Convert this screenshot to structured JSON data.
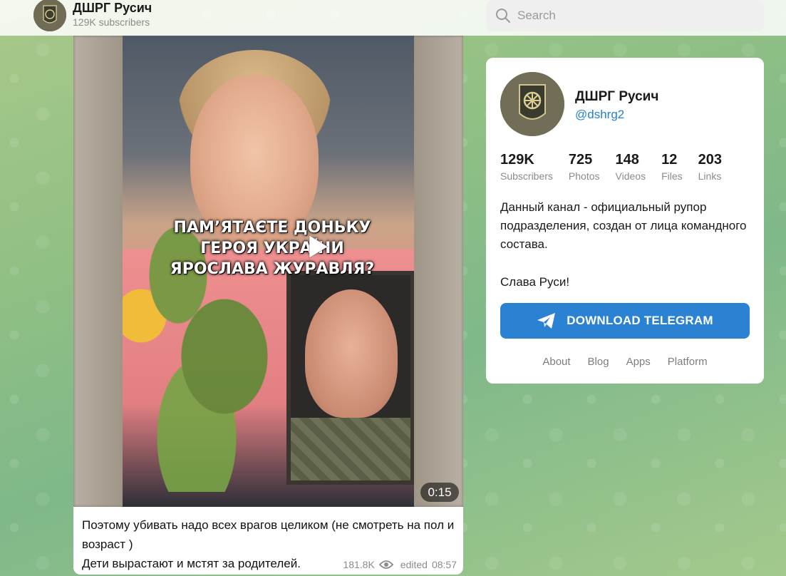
{
  "header": {
    "channel_name": "ДШРГ Русич",
    "subscribers_text": "129K subscribers",
    "avatar_icon": "channel-patch-avatar"
  },
  "search": {
    "placeholder": "Search",
    "icon": "search-icon"
  },
  "post": {
    "video": {
      "overlay_caption_lines": [
        "ПАМ’ЯТАЄТЕ ДОНЬКУ",
        "ГЕРОЯ УКРАЇНИ",
        "ЯРОСЛАВА ЖУРАВЛЯ?"
      ],
      "duration": "0:15",
      "play_icon": "play-icon"
    },
    "text_lines": [
      "Поэтому убивать надо всех врагов целиком (не смотреть на пол и возраст )",
      "Дети вырастают и мстят за родителей."
    ],
    "views": "181.8K",
    "edited_label": "edited",
    "time": "08:57"
  },
  "channel_card": {
    "name": "ДШРГ Русич",
    "handle": "@dshrg2",
    "stats": [
      {
        "value": "129K",
        "label": "Subscribers"
      },
      {
        "value": "725",
        "label": "Photos"
      },
      {
        "value": "148",
        "label": "Videos"
      },
      {
        "value": "12",
        "label": "Files"
      },
      {
        "value": "203",
        "label": "Links"
      }
    ],
    "description": [
      "Данный канал - официальный рупор подразделения, создан от лица командного состава.",
      "Слава Руси!"
    ],
    "download_button": "DOWNLOAD TELEGRAM",
    "footer_links": [
      "About",
      "Blog",
      "Apps",
      "Platform"
    ]
  },
  "colors": {
    "accent": "#2b82d2",
    "link": "#2481cc",
    "muted": "#8b8b8b"
  }
}
